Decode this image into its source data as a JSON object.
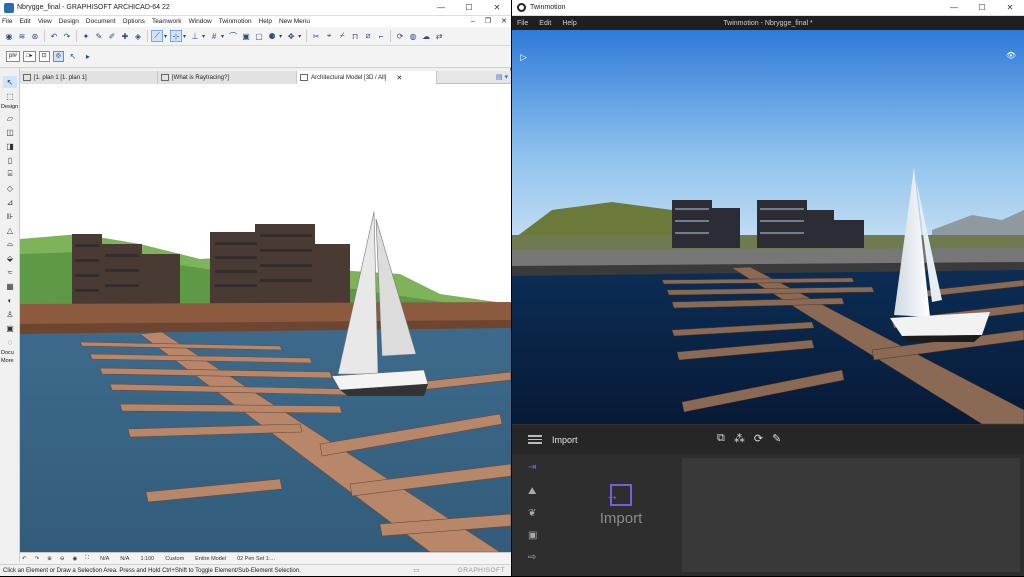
{
  "archicad": {
    "title": "Nbrygge_final - GRAPHISOFT ARCHICAD-64 22",
    "menu": [
      "File",
      "Edit",
      "View",
      "Design",
      "Document",
      "Options",
      "Teamwork",
      "Window",
      "Twinmotion",
      "Help",
      "New Menu"
    ],
    "tabs": [
      {
        "label": "[1. plan 1 [1. plan 1]"
      },
      {
        "label": "[What is Raytracing?]"
      },
      {
        "label": "Architectural Model [3D / All]"
      }
    ],
    "toolbox": {
      "design_label": "Design",
      "document_label": "Docu",
      "more_label": "More"
    },
    "info_box": {
      "arrow_value": "pl#"
    },
    "status_cells": [
      "N/A",
      "N/A",
      "1:100",
      "Custom",
      "Entire Model",
      "02 Pen Set 1:..."
    ],
    "status_message": "Click an Element or Draw a Selection Area. Press and Hold Ctrl+Shift to Toggle Element/Sub-Element Selection.",
    "brand": "GRAPHISOFT"
  },
  "twinmotion": {
    "title": "Twinmotion",
    "menu": [
      "File",
      "Edit",
      "Help"
    ],
    "document_title": "Twinmotion - Nbrygge_final *",
    "panel_label": "Import",
    "import_label": "Import"
  },
  "colors": {
    "accent_purple": "#7b5ed6",
    "selection_blue": "#cfe3fa"
  }
}
